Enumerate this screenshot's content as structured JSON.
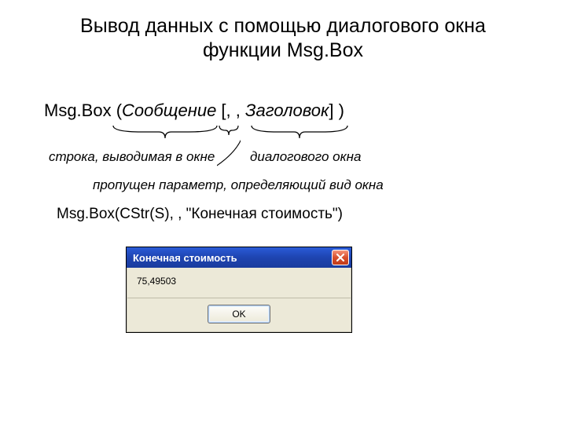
{
  "title": "Вывод данных с помощью диалогового окна функции Msg.Box",
  "syntax": {
    "prefix": "Msg.Box (",
    "arg1": "Сообщение",
    "mid": " [, , ",
    "arg2": "Заголовок",
    "suffix": "] )"
  },
  "caption1": "строка, выводимая в окне",
  "caption2": "диалогового окна",
  "caption3": "пропущен параметр, определяющий вид окна",
  "example": "Msg.Box(CStr(S), , \"Конечная стоимость\")",
  "dialog": {
    "title": "Конечная стоимость",
    "message": "75,49503",
    "ok": "OK"
  }
}
